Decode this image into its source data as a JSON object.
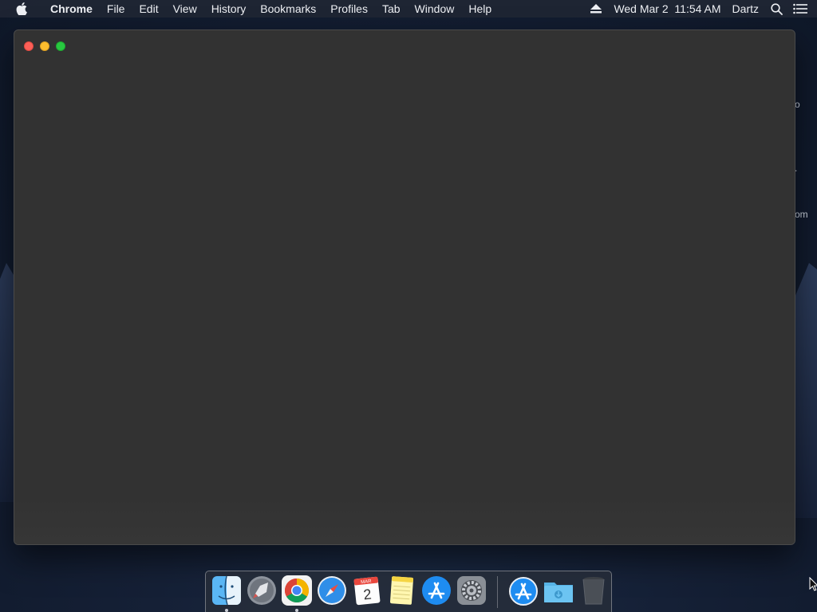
{
  "menubar": {
    "apple_icon": "apple-logo-icon",
    "app_name": "Chrome",
    "menus": [
      "File",
      "Edit",
      "View",
      "History",
      "Bookmarks",
      "Profiles",
      "Tab",
      "Window",
      "Help"
    ],
    "eject_icon": "eject-icon",
    "clock": "Wed Mar 2  11:54 AM",
    "user": "Dartz",
    "search_icon": "spotlight-search-icon",
    "list_icon": "notification-center-icon"
  },
  "desktop": {
    "peek_texts": [
      "o",
      ".",
      "om"
    ]
  },
  "window": {
    "app": "Chrome",
    "state": "blank",
    "controls": [
      "close",
      "minimize",
      "maximize"
    ]
  },
  "dock": {
    "apps": [
      {
        "name": "Finder",
        "icon": "finder-icon",
        "running": true
      },
      {
        "name": "Launchpad",
        "icon": "launchpad-icon",
        "running": false
      },
      {
        "name": "Chrome",
        "icon": "chrome-icon",
        "running": true
      },
      {
        "name": "Safari",
        "icon": "safari-icon",
        "running": false
      },
      {
        "name": "Calendar",
        "icon": "calendar-icon",
        "running": false,
        "month": "MAR",
        "day": "2"
      },
      {
        "name": "Notes",
        "icon": "notes-icon",
        "running": false
      },
      {
        "name": "App Store",
        "icon": "app-store-icon",
        "running": false
      },
      {
        "name": "System Preferences",
        "icon": "system-preferences-icon",
        "running": false
      }
    ],
    "right": [
      {
        "name": "Applications",
        "icon": "applications-stack-icon"
      },
      {
        "name": "Downloads",
        "icon": "downloads-folder-icon"
      },
      {
        "name": "Trash",
        "icon": "trash-icon"
      }
    ]
  },
  "colors": {
    "window_bg": "#323232",
    "close": "#fc5f57",
    "minimize": "#fdbd2e",
    "maximize": "#28c840"
  }
}
